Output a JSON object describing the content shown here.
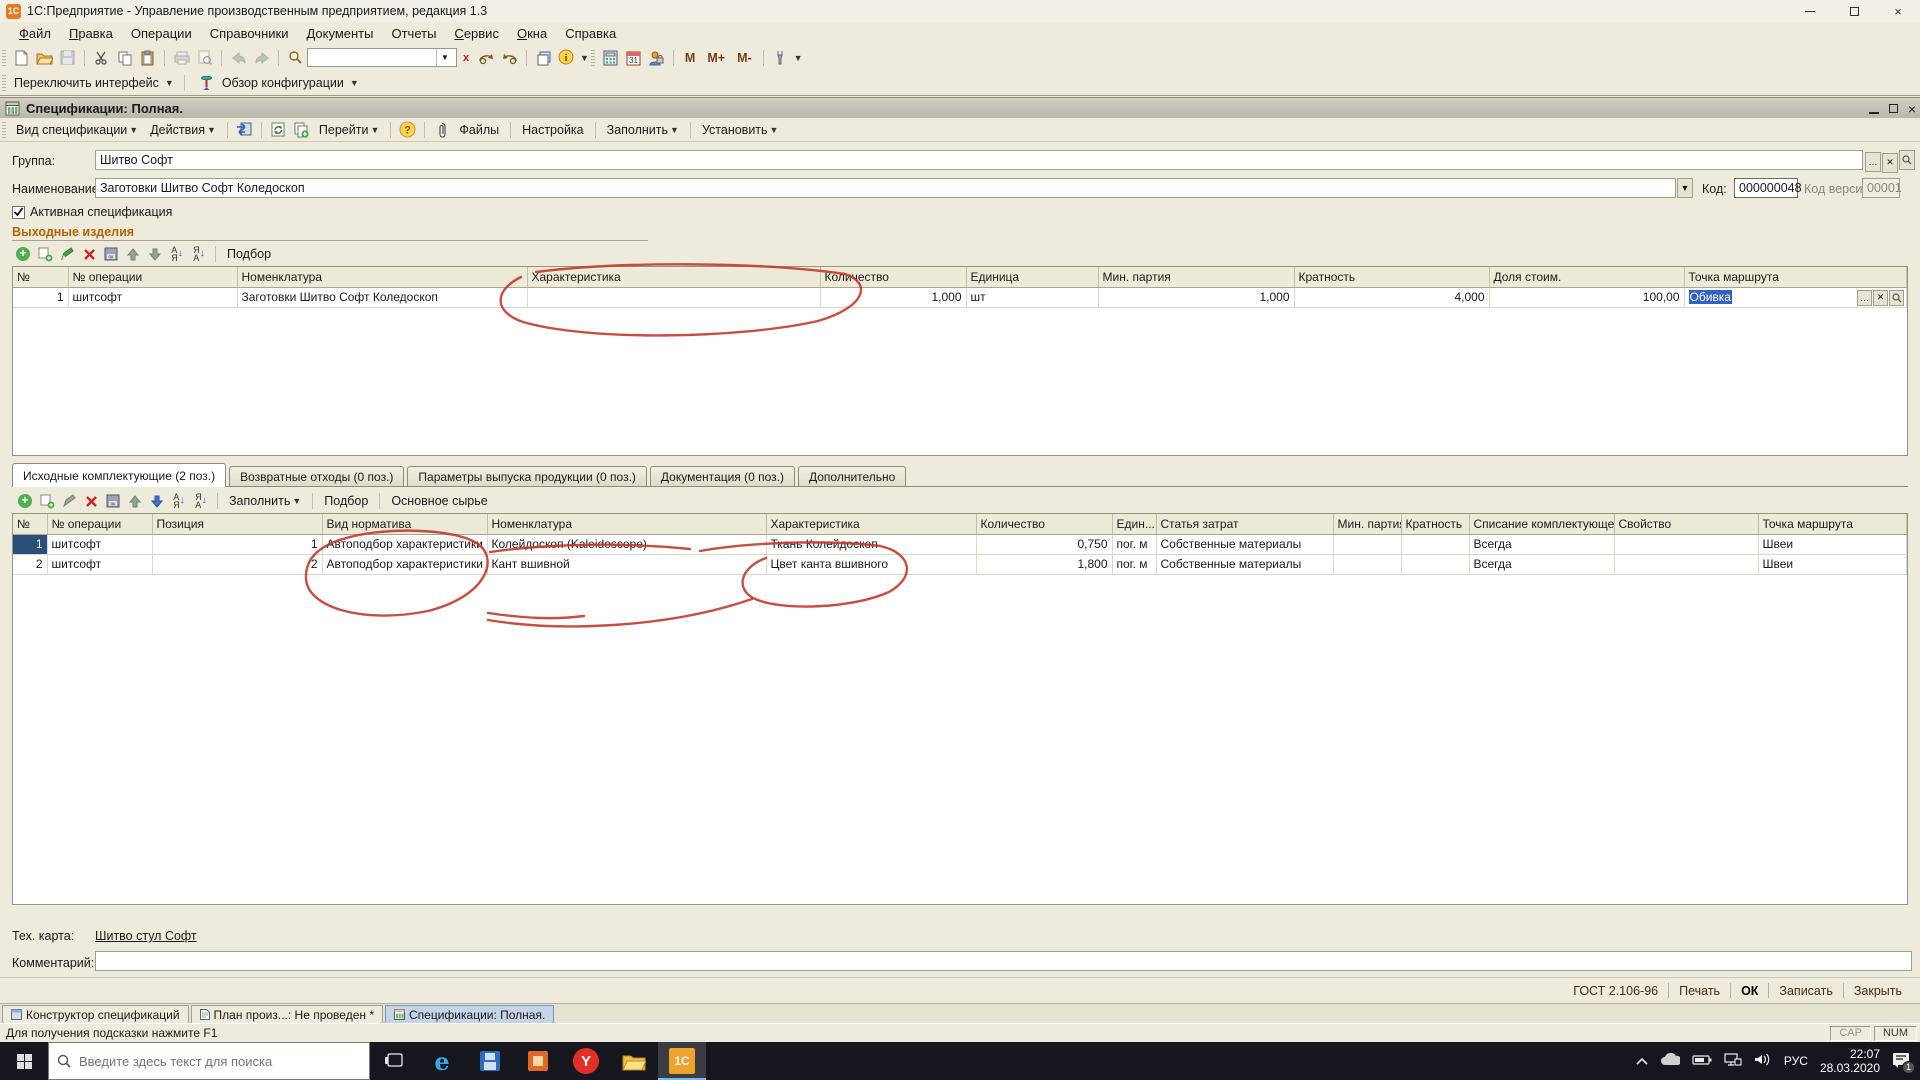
{
  "titlebar": {
    "title": "1С:Предприятие - Управление производственным предприятием, редакция 1.3"
  },
  "menu": {
    "items": [
      "Файл",
      "Правка",
      "Операции",
      "Справочники",
      "Документы",
      "Отчеты",
      "Сервис",
      "Окна",
      "Справка"
    ]
  },
  "main_toolbar": {
    "memory": [
      "M",
      "M+",
      "M-"
    ],
    "search_value": ""
  },
  "interface_toolbar": {
    "switch": "Переключить интерфейс",
    "overview": "Обзор конфигурации"
  },
  "doc_window": {
    "title": "Спецификации: Полная.",
    "toolbar": {
      "view": "Вид спецификации",
      "actions": "Действия",
      "goto": "Перейти",
      "files": "Файлы",
      "settings": "Настройка",
      "fill": "Заполнить",
      "set": "Установить"
    },
    "group": {
      "label": "Группа:",
      "value": "Шитво Софт"
    },
    "name": {
      "label": "Наименование:",
      "value": "Заготовки Шитво Софт Коледоскоп"
    },
    "code": {
      "label": "Код:",
      "value": "000000048"
    },
    "code_version": {
      "label": "Код версии:",
      "value": "00001"
    },
    "active_spec_label": "Активная спецификация",
    "output_section": {
      "title": "Выходные изделия",
      "pick": "Подбор",
      "columns": [
        "№",
        "№ операции",
        "Номенклатура",
        "Характеристика",
        "Количество",
        "Единица",
        "Мин. партия",
        "Кратность",
        "Доля стоим.",
        "Точка маршрута"
      ],
      "rows": [
        [
          "1",
          "шитсофт",
          "Заготовки Шитво Софт Коледоскоп",
          "",
          "1,000",
          "шт",
          "1,000",
          "4,000",
          "100,00",
          "Обивка"
        ]
      ]
    },
    "tabs": [
      "Исходные комплектующие (2 поз.)",
      "Возвратные отходы (0 поз.)",
      "Параметры выпуска продукции (0 поз.)",
      "Документация (0 поз.)",
      "Дополнительно"
    ],
    "components_section": {
      "fill": "Заполнить",
      "pick": "Подбор",
      "main_raw": "Основное сырье",
      "columns": [
        "№",
        "№ операции",
        "Позиция",
        "Вид норматива",
        "Номенклатура",
        "Характеристика",
        "Количество",
        "Един...",
        "Статья затрат",
        "Мин. партия",
        "Кратность",
        "Списание комплектующей",
        "Свойство",
        "Точка маршрута"
      ],
      "rows": [
        [
          "1",
          "шитсофт",
          "1",
          "Автоподбор характеристики",
          "Колейдоскоп (Kaleidoscope)",
          "Ткань Колейдоскоп",
          "0,750",
          "пог. м",
          "Собственные материалы",
          "",
          "",
          "Всегда",
          "",
          "Швеи"
        ],
        [
          "2",
          "шитсофт",
          "2",
          "Автоподбор характеристики",
          "Кант вшивной",
          "Цвет канта вшивного",
          "1,800",
          "пог. м",
          "Собственные материалы",
          "",
          "",
          "Всегда",
          "",
          "Швеи"
        ]
      ]
    },
    "tech_card": {
      "label": "Тех. карта:",
      "value": "Шитво стул Софт"
    },
    "comment": {
      "label": "Комментарий:",
      "value": ""
    },
    "footer_buttons": [
      "ГОСТ 2.106-96",
      "Печать",
      "ОК",
      "Записать",
      "Закрыть"
    ]
  },
  "mdi_tabs": {
    "items": [
      "Конструктор спецификаций",
      "План произ...: Не проведен *",
      "Спецификации: Полная."
    ]
  },
  "status_bar": {
    "hint": "Для получения подсказки нажмите F1",
    "cap": "CAP",
    "num": "NUM"
  },
  "taskbar": {
    "search_placeholder": "Введите здесь текст для поиска",
    "lang": "РУС",
    "time": "22:07",
    "date": "28.03.2020",
    "badge": "1"
  }
}
